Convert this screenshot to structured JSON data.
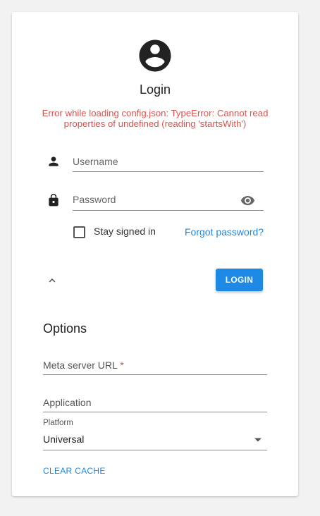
{
  "login": {
    "title": "Login",
    "error": "Error while loading config.json: TypeError: Cannot read properties of undefined (reading 'startsWith')",
    "username_placeholder": "Username",
    "password_placeholder": "Password",
    "stay_signed_in": "Stay signed in",
    "stay_signed_in_checked": false,
    "forgot_password": "Forgot password?",
    "login_button": "LOGIN"
  },
  "options": {
    "title": "Options",
    "meta_server_label": "Meta server URL",
    "required_mark": "*",
    "application_label": "Application",
    "platform_label": "Platform",
    "platform_value": "Universal",
    "clear_cache": "CLEAR CACHE"
  },
  "icons": {
    "avatar": "account-circle-icon",
    "username": "person-icon",
    "password": "lock-icon",
    "visibility": "eye-icon",
    "collapse": "chevron-up-icon",
    "dropdown": "dropdown-arrow-icon"
  },
  "colors": {
    "accent": "#1e88e5",
    "error": "#d9534f",
    "background": "#f2f2f2",
    "card": "#ffffff"
  }
}
